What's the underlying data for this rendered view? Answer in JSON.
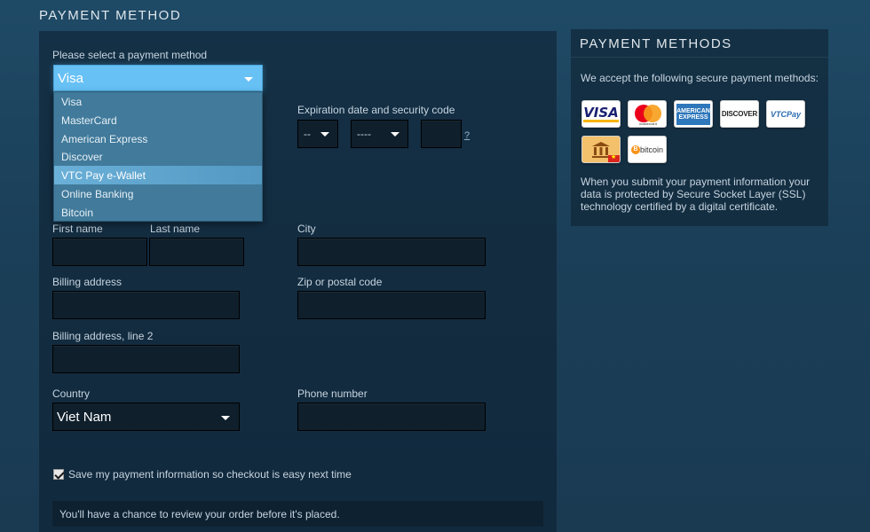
{
  "page_title": "PAYMENT METHOD",
  "payment_select": {
    "label": "Please select a payment method",
    "value": "Visa",
    "options": [
      "Visa",
      "MasterCard",
      "American Express",
      "Discover",
      "VTC Pay e-Wallet",
      "Online Banking",
      "Bitcoin"
    ],
    "hovered": "VTC Pay e-Wallet"
  },
  "expiration": {
    "label": "Expiration date and security code",
    "month_value": "--",
    "year_value": "----",
    "help": "?"
  },
  "fields": {
    "first_name": "First name",
    "last_name": "Last name",
    "city": "City",
    "billing_address": "Billing address",
    "zip": "Zip or postal code",
    "billing_address_2": "Billing address, line 2",
    "country": "Country",
    "phone": "Phone number"
  },
  "country_value": "Viet Nam",
  "save_checkbox": {
    "label": "Save my payment information so checkout is easy next time",
    "checked": true
  },
  "review_note": "You'll have a chance to review your order before it's placed.",
  "side_panel": {
    "title": "PAYMENT METHODS",
    "intro": "We accept the following secure payment methods:",
    "icons": [
      {
        "name": "visa-icon",
        "text": "VISA"
      },
      {
        "name": "mastercard-icon",
        "text": "mastercard"
      },
      {
        "name": "american-express-icon",
        "text": "AMERICAN EXPRESS"
      },
      {
        "name": "discover-icon",
        "text": "DISCOVER"
      },
      {
        "name": "vtc-pay-icon",
        "text": "VTCPay"
      },
      {
        "name": "online-banking-icon",
        "text": ""
      },
      {
        "name": "bitcoin-icon",
        "text": "bitcoin"
      }
    ],
    "ssl_note": "When you submit your payment information your data is protected by Secure Socket Layer (SSL) technology certified by a digital certificate."
  },
  "colors": {
    "accent": "#67c1f5",
    "dropdown_bg": "#417a9b",
    "field_bg": "#0f1f2c"
  }
}
